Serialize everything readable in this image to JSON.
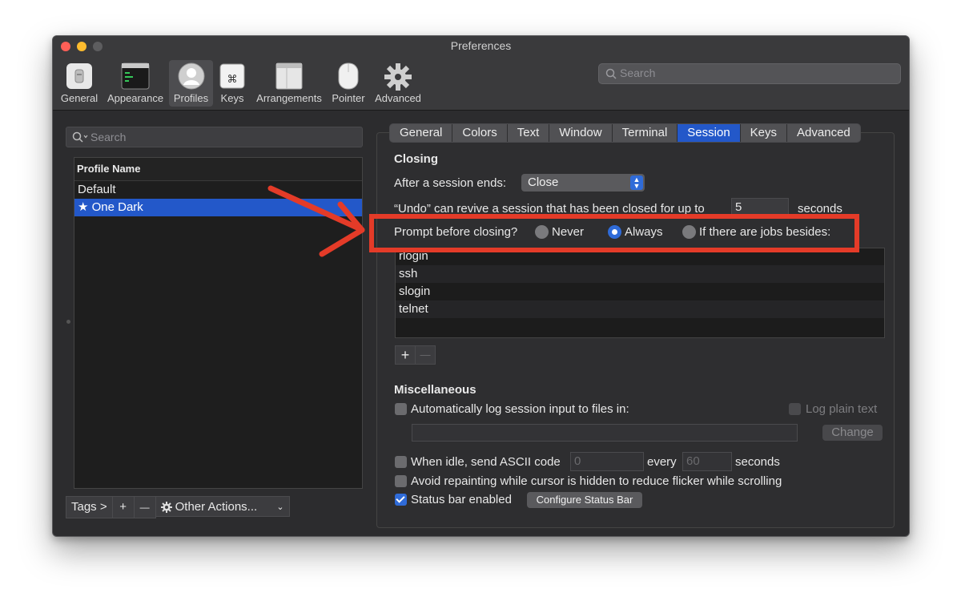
{
  "window": {
    "title": "Preferences"
  },
  "toolbar": {
    "items": [
      {
        "label": "General",
        "icon": "general-switch-icon"
      },
      {
        "label": "Appearance",
        "icon": "appearance-window-icon"
      },
      {
        "label": "Profiles",
        "icon": "profiles-person-icon"
      },
      {
        "label": "Keys",
        "icon": "keys-command-icon"
      },
      {
        "label": "Arrangements",
        "icon": "arrangements-icon"
      },
      {
        "label": "Pointer",
        "icon": "pointer-mouse-icon"
      },
      {
        "label": "Advanced",
        "icon": "advanced-gear-icon"
      }
    ],
    "selected": "Profiles",
    "search_placeholder": "Search"
  },
  "profiles": {
    "search_placeholder": "Search",
    "header": "Profile Name",
    "rows": [
      "Default",
      "★ One Dark"
    ],
    "selected": "★ One Dark",
    "bottom": {
      "tags": "Tags >",
      "add": "+",
      "remove": "—",
      "other_actions": "Other Actions..."
    }
  },
  "tabs": [
    "General",
    "Colors",
    "Text",
    "Window",
    "Terminal",
    "Session",
    "Keys",
    "Advanced"
  ],
  "active_tab": "Session",
  "closing": {
    "heading": "Closing",
    "after_label": "After a session ends:",
    "after_value": "Close",
    "undo_prefix": "“Undo” can revive a session that has been closed for up to",
    "undo_value": "5",
    "undo_suffix": "seconds",
    "prompt_label": "Prompt before closing?",
    "options": [
      "Never",
      "Always",
      "If there are jobs besides:"
    ],
    "selected_option": "Always",
    "jobs": [
      "rlogin",
      "ssh",
      "slogin",
      "telnet"
    ],
    "add": "+",
    "remove": "—"
  },
  "misc": {
    "heading": "Miscellaneous",
    "autolog_label": "Automatically log session input to files in:",
    "log_plain": "Log plain text",
    "change_button": "Change",
    "idle_label": "When idle, send ASCII code",
    "idle_code": "0",
    "every_label": "every",
    "every_value": "60",
    "seconds_label": "seconds",
    "avoid_label": "Avoid repainting while cursor is hidden to reduce flicker while scrolling",
    "status_bar_label": "Status bar enabled",
    "configure_button": "Configure Status Bar",
    "status_bar_checked": true
  },
  "annotation": {
    "color": "#e43b28"
  }
}
